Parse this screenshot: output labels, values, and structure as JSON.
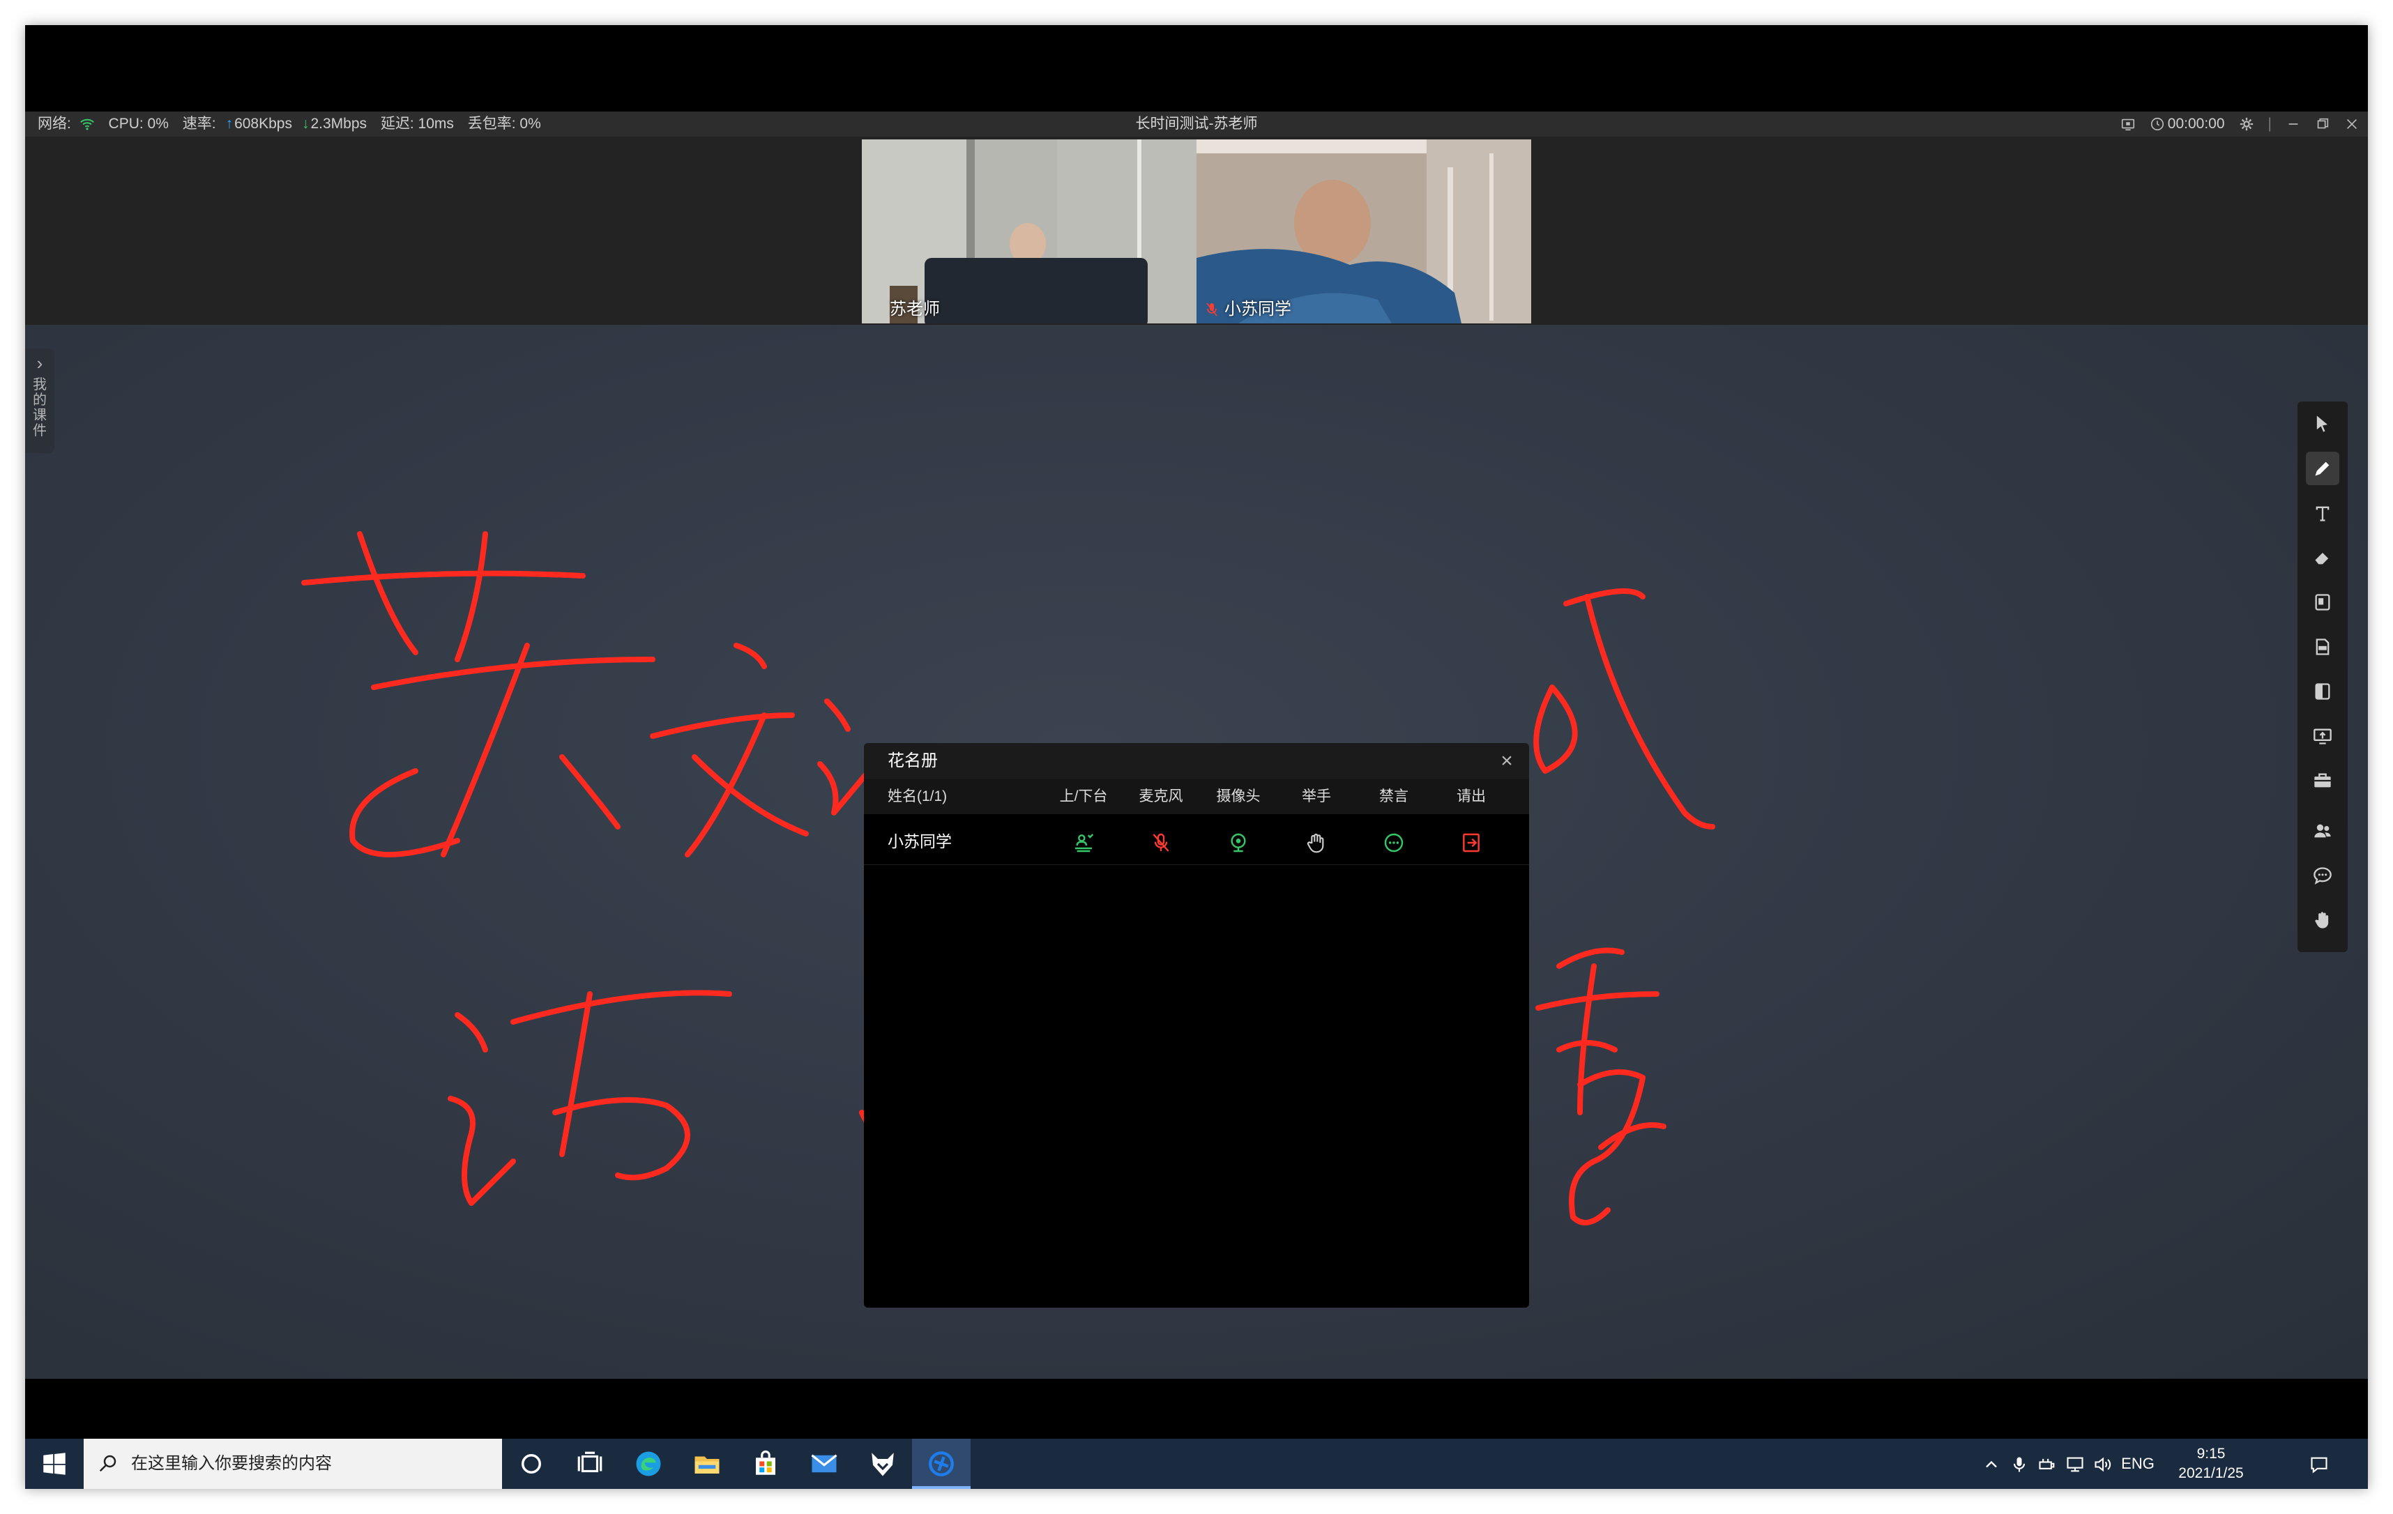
{
  "status": {
    "network_label": "网络:",
    "cpu": "CPU: 0%",
    "speed_label": "速率:",
    "upload": "608Kbps",
    "download": "2.3Mbps",
    "latency": "延迟: 10ms",
    "packet_loss": "丢包率: 0%",
    "title": "长时间测试-苏老师",
    "timer": "00:00:00"
  },
  "videos": [
    {
      "name": "苏老师"
    },
    {
      "name": "小苏同学"
    }
  ],
  "courseware": {
    "label": "我的课件"
  },
  "tools": [
    "cursor-icon",
    "pen-icon",
    "text-icon",
    "eraser-icon",
    "ppt-icon",
    "pdf-icon",
    "word-icon",
    "share-screen-icon",
    "toolbox-icon",
    "roster-icon",
    "chat-icon",
    "hand-icon"
  ],
  "roster": {
    "title": "花名册",
    "columns": {
      "name": "姓名(1/1)",
      "stage": "上/下台",
      "mic": "麦克风",
      "camera": "摄像头",
      "hand": "举手",
      "mute": "禁言",
      "kick": "请出"
    },
    "rows": [
      {
        "name": "小苏同学"
      }
    ]
  },
  "taskbar": {
    "search_placeholder": "在这里输入你要搜索的内容",
    "lang": "ENG",
    "time": "9:15",
    "date": "2021/1/25"
  },
  "colors": {
    "ink": "#ff2a1f",
    "green": "#35c76a",
    "red": "#ff3b30",
    "board": "#313844"
  }
}
